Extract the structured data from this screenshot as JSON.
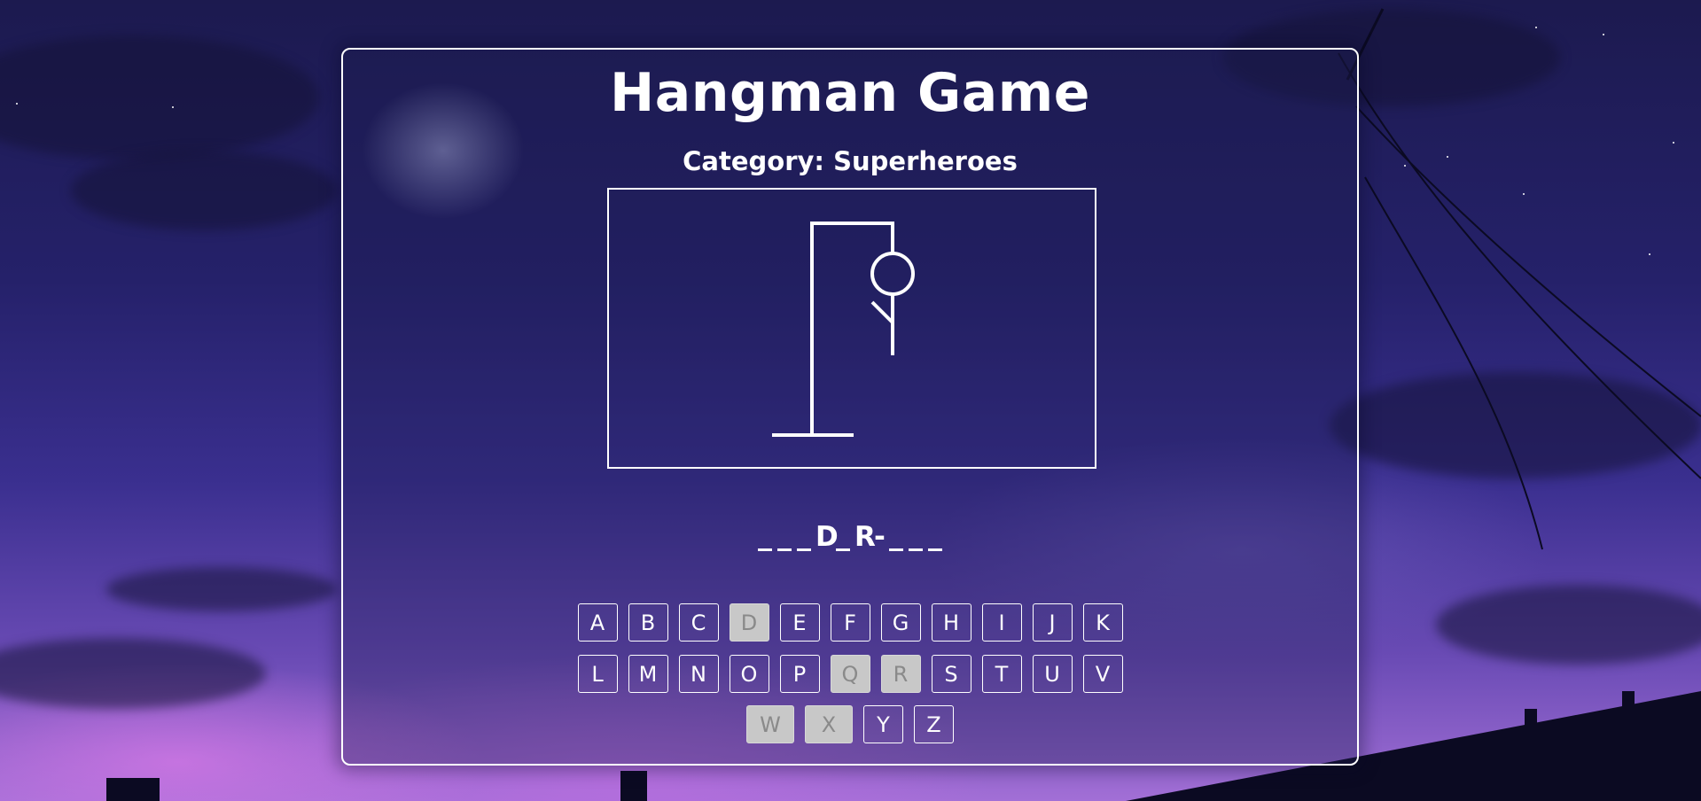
{
  "game": {
    "title": "Hangman Game",
    "category_label": "Category:",
    "category_value": "Superheroes",
    "category_text": "Category: Superheroes"
  },
  "hangman": {
    "parts_drawn": [
      "head",
      "body",
      "left-arm"
    ],
    "wrong_guesses": 3
  },
  "word": [
    {
      "char": "",
      "revealed": false
    },
    {
      "char": "",
      "revealed": false
    },
    {
      "char": "",
      "revealed": false
    },
    {
      "char": "D",
      "revealed": true
    },
    {
      "char": "",
      "revealed": false
    },
    {
      "char": "R",
      "revealed": true
    },
    {
      "char": "-",
      "revealed": true,
      "hyphen": true
    },
    {
      "char": "",
      "revealed": false
    },
    {
      "char": "",
      "revealed": false
    },
    {
      "char": "",
      "revealed": false
    }
  ],
  "keyboard": {
    "rows": [
      [
        {
          "letter": "A",
          "used": false
        },
        {
          "letter": "B",
          "used": false
        },
        {
          "letter": "C",
          "used": false
        },
        {
          "letter": "D",
          "used": true
        },
        {
          "letter": "E",
          "used": false
        },
        {
          "letter": "F",
          "used": false
        },
        {
          "letter": "G",
          "used": false
        },
        {
          "letter": "H",
          "used": false
        },
        {
          "letter": "I",
          "used": false
        },
        {
          "letter": "J",
          "used": false
        },
        {
          "letter": "K",
          "used": false
        }
      ],
      [
        {
          "letter": "L",
          "used": false
        },
        {
          "letter": "M",
          "used": false
        },
        {
          "letter": "N",
          "used": false
        },
        {
          "letter": "O",
          "used": false
        },
        {
          "letter": "P",
          "used": false
        },
        {
          "letter": "Q",
          "used": true
        },
        {
          "letter": "R",
          "used": true
        },
        {
          "letter": "S",
          "used": false
        },
        {
          "letter": "T",
          "used": false
        },
        {
          "letter": "U",
          "used": false
        },
        {
          "letter": "V",
          "used": false
        }
      ],
      [
        {
          "letter": "W",
          "used": true
        },
        {
          "letter": "X",
          "used": true
        },
        {
          "letter": "Y",
          "used": false
        },
        {
          "letter": "Z",
          "used": false
        }
      ]
    ]
  },
  "colors": {
    "accent": "#ffffff",
    "used_key_bg": "#c8c8c8",
    "used_key_text": "#8a8a8a"
  }
}
